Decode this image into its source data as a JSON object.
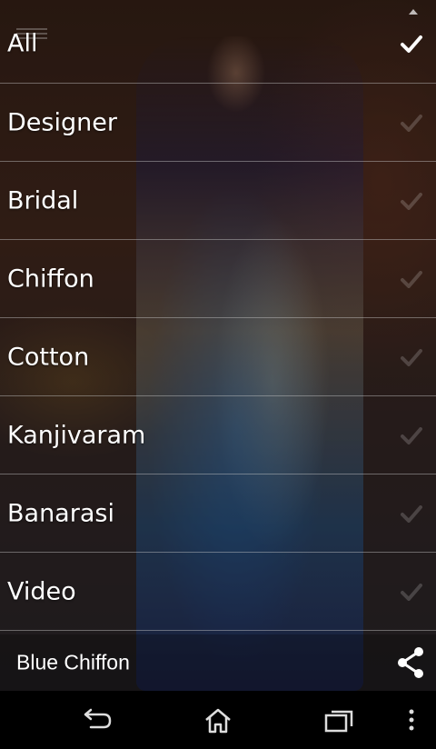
{
  "menu": {
    "items": [
      {
        "label": "All",
        "selected": true
      },
      {
        "label": "Designer",
        "selected": false
      },
      {
        "label": "Bridal",
        "selected": false
      },
      {
        "label": "Chiffon",
        "selected": false
      },
      {
        "label": "Cotton",
        "selected": false
      },
      {
        "label": "Kanjivaram",
        "selected": false
      },
      {
        "label": "Banarasi",
        "selected": false
      },
      {
        "label": "Video",
        "selected": false
      }
    ]
  },
  "caption": {
    "title": "Blue Chiffon",
    "share_icon": "share-icon"
  },
  "navbar": {
    "back_icon": "back-icon",
    "home_icon": "home-icon",
    "recents_icon": "recent-apps-icon",
    "overflow_icon": "overflow-menu-icon"
  },
  "colors": {
    "text": "#ffffff",
    "divider": "#c8c8c8",
    "navbar": "#000000"
  }
}
